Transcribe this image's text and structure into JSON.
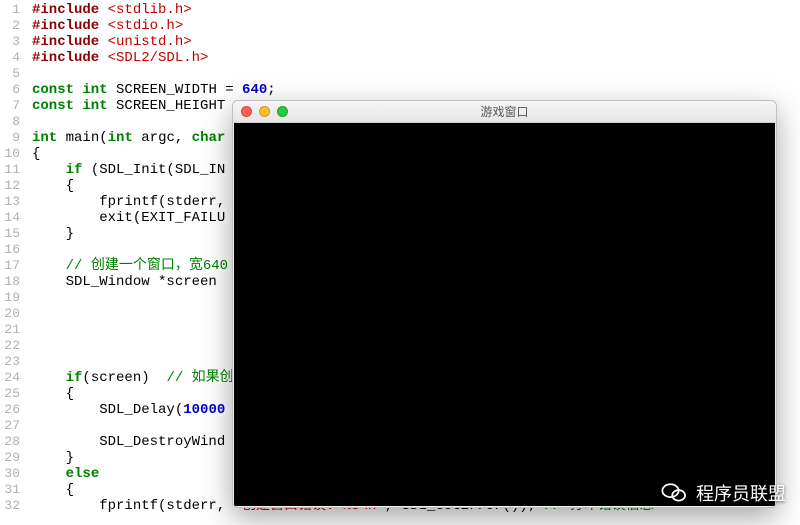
{
  "lines": [
    {
      "n": 1,
      "tokens": [
        [
          "pp",
          "#include "
        ],
        [
          "ang",
          "<stdlib.h>"
        ]
      ]
    },
    {
      "n": 2,
      "tokens": [
        [
          "pp",
          "#include "
        ],
        [
          "ang",
          "<stdio.h>"
        ]
      ]
    },
    {
      "n": 3,
      "tokens": [
        [
          "pp",
          "#include "
        ],
        [
          "ang",
          "<unistd.h>"
        ]
      ]
    },
    {
      "n": 4,
      "tokens": [
        [
          "pp",
          "#include "
        ],
        [
          "ang",
          "<SDL2/SDL.h>"
        ]
      ]
    },
    {
      "n": 5,
      "tokens": []
    },
    {
      "n": 6,
      "tokens": [
        [
          "kw",
          "const int"
        ],
        [
          "text",
          " SCREEN_WIDTH = "
        ],
        [
          "num",
          "640"
        ],
        [
          "text",
          ";"
        ]
      ]
    },
    {
      "n": 7,
      "tokens": [
        [
          "kw",
          "const int"
        ],
        [
          "text",
          " SCREEN_HEIGHT"
        ]
      ]
    },
    {
      "n": 8,
      "tokens": []
    },
    {
      "n": 9,
      "tokens": [
        [
          "kw",
          "int"
        ],
        [
          "text",
          " main("
        ],
        [
          "kw",
          "int"
        ],
        [
          "text",
          " argc, "
        ],
        [
          "kw",
          "char"
        ]
      ]
    },
    {
      "n": 10,
      "tokens": [
        [
          "text",
          "{"
        ]
      ]
    },
    {
      "n": 11,
      "tokens": [
        [
          "text",
          "    "
        ],
        [
          "kw",
          "if"
        ],
        [
          "text",
          " (SDL_Init(SDL_IN"
        ]
      ]
    },
    {
      "n": 12,
      "tokens": [
        [
          "text",
          "    {"
        ]
      ]
    },
    {
      "n": 13,
      "tokens": [
        [
          "text",
          "        fprintf(stderr,"
        ]
      ]
    },
    {
      "n": 14,
      "tokens": [
        [
          "text",
          "        exit(EXIT_FAILU"
        ]
      ]
    },
    {
      "n": 15,
      "tokens": [
        [
          "text",
          "    }"
        ]
      ]
    },
    {
      "n": 16,
      "tokens": []
    },
    {
      "n": 17,
      "tokens": [
        [
          "text",
          "    "
        ],
        [
          "cmt",
          "// 创建一个窗口，宽640"
        ]
      ]
    },
    {
      "n": 18,
      "tokens": [
        [
          "text",
          "    SDL_Window *screen"
        ]
      ]
    },
    {
      "n": 19,
      "tokens": []
    },
    {
      "n": 20,
      "tokens": []
    },
    {
      "n": 21,
      "tokens": []
    },
    {
      "n": 22,
      "tokens": []
    },
    {
      "n": 23,
      "tokens": []
    },
    {
      "n": 24,
      "tokens": [
        [
          "text",
          "    "
        ],
        [
          "kw",
          "if"
        ],
        [
          "text",
          "(screen)  "
        ],
        [
          "cmt",
          "// 如果创"
        ]
      ]
    },
    {
      "n": 25,
      "tokens": [
        [
          "text",
          "    {"
        ]
      ]
    },
    {
      "n": 26,
      "tokens": [
        [
          "text",
          "        SDL_Delay("
        ],
        [
          "num",
          "10000"
        ]
      ]
    },
    {
      "n": 27,
      "tokens": []
    },
    {
      "n": 28,
      "tokens": [
        [
          "text",
          "        SDL_DestroyWind"
        ]
      ]
    },
    {
      "n": 29,
      "tokens": [
        [
          "text",
          "    }"
        ]
      ]
    },
    {
      "n": 30,
      "tokens": [
        [
          "text",
          "    "
        ],
        [
          "kw",
          "else"
        ]
      ]
    },
    {
      "n": 31,
      "tokens": [
        [
          "text",
          "    {"
        ]
      ]
    },
    {
      "n": 32,
      "tokens": [
        [
          "text",
          "        fprintf(stderr, "
        ],
        [
          "str",
          "\"创建窗口错误: %s\\n\""
        ],
        [
          "text",
          ", SDL_GetError()); "
        ],
        [
          "cmt",
          "// 打印错误信息"
        ]
      ]
    }
  ],
  "window": {
    "title": "游戏窗口"
  },
  "watermark": {
    "text": "程序员联盟"
  }
}
